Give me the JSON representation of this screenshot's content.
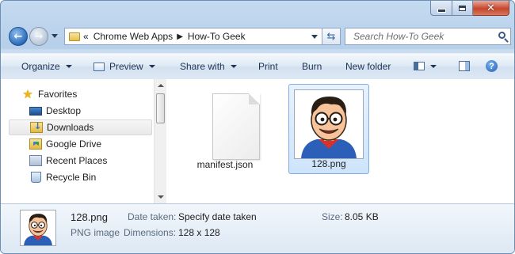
{
  "window": {
    "caption": {
      "minimize_icon": "minimize-icon",
      "maximize_icon": "maximize-icon",
      "close_glyph": "✕"
    }
  },
  "nav": {
    "back_glyph": "←",
    "forward_glyph": "→",
    "chevrons": "«",
    "breadcrumb": [
      "Chrome Web Apps",
      "How-To Geek"
    ],
    "crumb_arrow": "▶",
    "refresh_glyph": "⇆",
    "search_placeholder": "Search How-To Geek"
  },
  "toolbar": {
    "organize": "Organize",
    "preview": "Preview",
    "share_with": "Share with",
    "print": "Print",
    "burn": "Burn",
    "new_folder": "New folder",
    "help_glyph": "?"
  },
  "sidebar": {
    "items": [
      {
        "label": "Favorites",
        "icon": "star-icon"
      },
      {
        "label": "Desktop",
        "icon": "desktop-icon"
      },
      {
        "label": "Downloads",
        "icon": "downloads-folder-icon",
        "selected": true
      },
      {
        "label": "Google Drive",
        "icon": "google-drive-folder-icon"
      },
      {
        "label": "Recent Places",
        "icon": "recent-places-icon"
      },
      {
        "label": "Recycle Bin",
        "icon": "recycle-bin-icon"
      }
    ]
  },
  "files": [
    {
      "name": "manifest.json",
      "icon": "document-icon"
    },
    {
      "name": "128.png",
      "icon": "image-thumbnail",
      "selected": true
    }
  ],
  "details": {
    "filename": "128.png",
    "type": "PNG image",
    "date_taken_label": "Date taken:",
    "date_taken_value": "Specify date taken",
    "dimensions_label": "Dimensions:",
    "dimensions_value": "128 x 128",
    "size_label": "Size:",
    "size_value": "8.05 KB"
  },
  "colors": {
    "accent": "#3568a8",
    "selection": "#cde4fb",
    "close": "#c6462c"
  }
}
